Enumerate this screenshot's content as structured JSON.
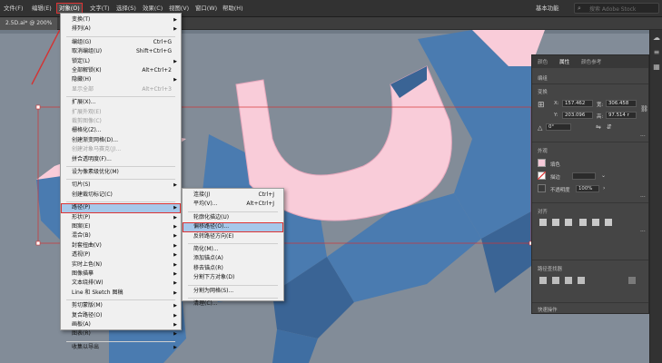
{
  "menubar": {
    "items": [
      "文件(F)",
      "编辑(E)",
      "对象(O)",
      "文字(T)",
      "选择(S)",
      "效果(C)",
      "视图(V)",
      "窗口(W)",
      "帮助(H)"
    ],
    "active_index": 2,
    "workspace": "基本功能",
    "search_placeholder": "搜索 Adobe Stock"
  },
  "document": {
    "tab": "2.5D.ai* @ 200%"
  },
  "object_menu": {
    "items": [
      {
        "label": "变换(T)",
        "submenu": true
      },
      {
        "label": "排列(A)",
        "submenu": true
      },
      {
        "sep": true
      },
      {
        "label": "编组(G)",
        "shortcut": "Ctrl+G"
      },
      {
        "label": "取消编组(U)",
        "shortcut": "Shift+Ctrl+G"
      },
      {
        "label": "锁定(L)",
        "submenu": true
      },
      {
        "label": "全部解锁(K)",
        "shortcut": "Alt+Ctrl+2"
      },
      {
        "label": "隐藏(H)",
        "submenu": true
      },
      {
        "label": "显示全部",
        "shortcut": "Alt+Ctrl+3",
        "disabled": true
      },
      {
        "sep": true
      },
      {
        "label": "扩展(X)..."
      },
      {
        "label": "扩展外观(E)",
        "disabled": true
      },
      {
        "label": "裁剪图像(C)",
        "disabled": true
      },
      {
        "label": "栅格化(Z)..."
      },
      {
        "label": "创建渐变网格(D)..."
      },
      {
        "label": "创建对象马赛克(J)...",
        "disabled": true
      },
      {
        "label": "拼合透明度(F)..."
      },
      {
        "sep": true
      },
      {
        "label": "设为像素级优化(M)"
      },
      {
        "sep": true
      },
      {
        "label": "切片(S)",
        "submenu": true
      },
      {
        "label": "创建裁切标记(C)"
      },
      {
        "sep": true
      },
      {
        "label": "路径(P)",
        "submenu": true,
        "highlighted": true
      },
      {
        "label": "形状(P)",
        "submenu": true
      },
      {
        "label": "图案(E)",
        "submenu": true
      },
      {
        "label": "混合(B)",
        "submenu": true
      },
      {
        "label": "封套扭曲(V)",
        "submenu": true
      },
      {
        "label": "透视(P)",
        "submenu": true
      },
      {
        "label": "实时上色(N)",
        "submenu": true
      },
      {
        "label": "图像描摹",
        "submenu": true
      },
      {
        "label": "文本绕排(W)",
        "submenu": true
      },
      {
        "label": "Line 和 Sketch 图稿",
        "submenu": true
      },
      {
        "sep": true
      },
      {
        "label": "剪切蒙版(M)",
        "submenu": true
      },
      {
        "label": "复合路径(O)",
        "submenu": true
      },
      {
        "label": "画板(A)",
        "submenu": true
      },
      {
        "label": "图表(R)",
        "submenu": true
      },
      {
        "sep": true
      },
      {
        "label": "收集以导出",
        "submenu": true
      }
    ]
  },
  "path_submenu": {
    "items": [
      {
        "label": "连接(J)",
        "shortcut": "Ctrl+J"
      },
      {
        "label": "平均(V)...",
        "shortcut": "Alt+Ctrl+J"
      },
      {
        "sep": true
      },
      {
        "label": "轮廓化描边(U)"
      },
      {
        "label": "偏移路径(O)...",
        "highlighted": true
      },
      {
        "label": "反转路径方向(E)"
      },
      {
        "sep": true
      },
      {
        "label": "简化(M)..."
      },
      {
        "label": "添加锚点(A)"
      },
      {
        "label": "移去锚点(R)"
      },
      {
        "label": "分割下方对象(D)"
      },
      {
        "sep": true
      },
      {
        "label": "分割为网格(S)..."
      },
      {
        "sep": true
      },
      {
        "label": "清理(C)..."
      }
    ]
  },
  "panel": {
    "tabs": [
      "颜色",
      "属性",
      "颜色参考"
    ],
    "active_tab": 1,
    "section_shape": "编组",
    "section_transform": "变换",
    "x_label": "X:",
    "x_value": "157.462",
    "y_label": "Y:",
    "y_value": "203.096",
    "w_label": "宽:",
    "w_value": "306.458",
    "h_label": "高:",
    "h_value": "97.514 r",
    "angle_value": "0°",
    "section_appearance": "外观",
    "fill_label": "填色",
    "stroke_label": "描边",
    "opacity_label": "不透明度",
    "opacity_value": "100%",
    "section_align": "对齐",
    "section_pathfinder": "路径查找器",
    "section_quick_actions": "快速操作",
    "fill_color": "#f6c9d8",
    "stroke_color": "#ffffff"
  },
  "colors": {
    "letter_face": "#f9ccd9",
    "letter_side": "#4a7bb0",
    "letter_side_dark": "#3a6495",
    "canvas_bg": "#828c98",
    "menu_highlight": "#a6c8ea",
    "red_outline": "#d33333"
  }
}
